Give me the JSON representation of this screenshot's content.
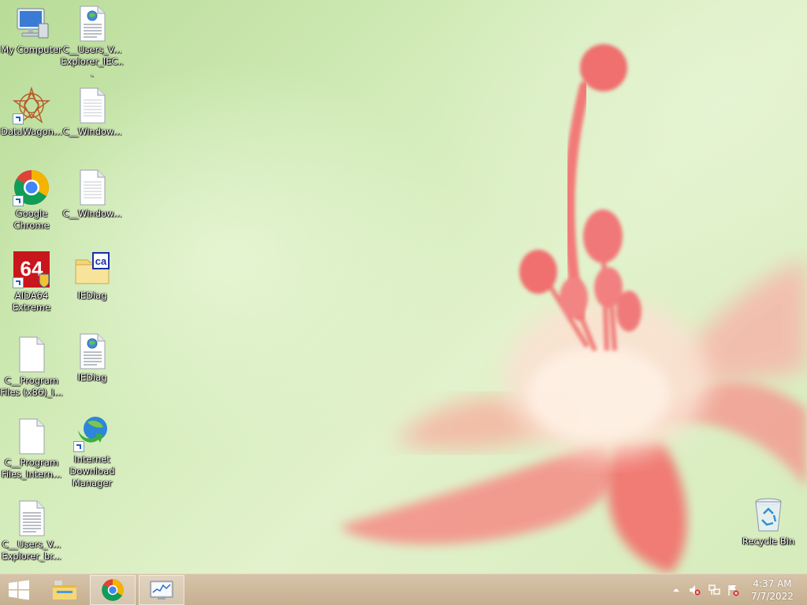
{
  "desktop": {
    "icons": [
      {
        "label": "My Computer"
      },
      {
        "label": "C__Users_V... Explorer_IEC..."
      },
      {
        "label": "DataWagon..."
      },
      {
        "label": "C__Window..."
      },
      {
        "label": "Google Chrome"
      },
      {
        "label": "C__Window..."
      },
      {
        "label": "AIDA64 Extreme"
      },
      {
        "label": "IEDiag"
      },
      {
        "label": "C__Program Files (x86)_I..."
      },
      {
        "label": "IEDiag"
      },
      {
        "label": "C__Program Files_Intern..."
      },
      {
        "label": "Internet Download Manager"
      },
      {
        "label": "C__Users_V... Explorer_br..."
      },
      {
        "label": "Recycle Bin"
      }
    ],
    "aida_badge": "64",
    "iediag_badge": "ca"
  },
  "taskbar": {
    "start_icon": "windows-logo-icon",
    "pinned": [
      {
        "icon": "file-explorer-icon"
      },
      {
        "icon": "chrome-icon"
      },
      {
        "icon": "performance-monitor-icon"
      }
    ],
    "tray": {
      "icons": [
        "show-hidden-icons-chevron",
        "speaker-muted-icon",
        "network-icon",
        "action-center-flag-icon"
      ]
    },
    "clock": {
      "time": "4:37 AM",
      "date": "7/7/2022"
    }
  },
  "colors": {
    "taskbar": "#c9b495",
    "wallpaper_green": "#cfe8b4",
    "flower_pink": "#f07a72"
  }
}
